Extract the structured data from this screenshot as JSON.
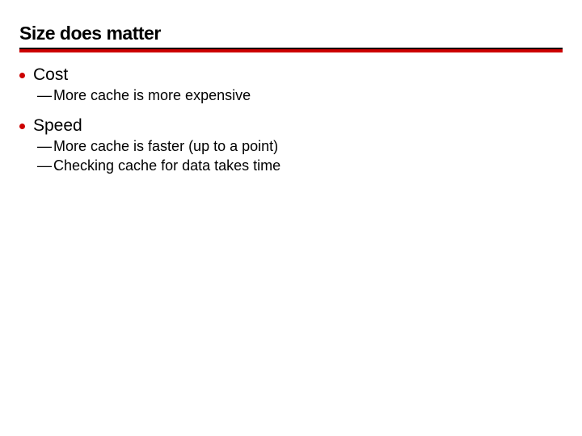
{
  "title": "Size does matter",
  "items": [
    {
      "label": "Cost",
      "sub": [
        "More cache is more expensive"
      ]
    },
    {
      "label": "Speed",
      "sub": [
        "More cache is faster (up to a point)",
        "Checking cache for data takes time"
      ]
    }
  ]
}
